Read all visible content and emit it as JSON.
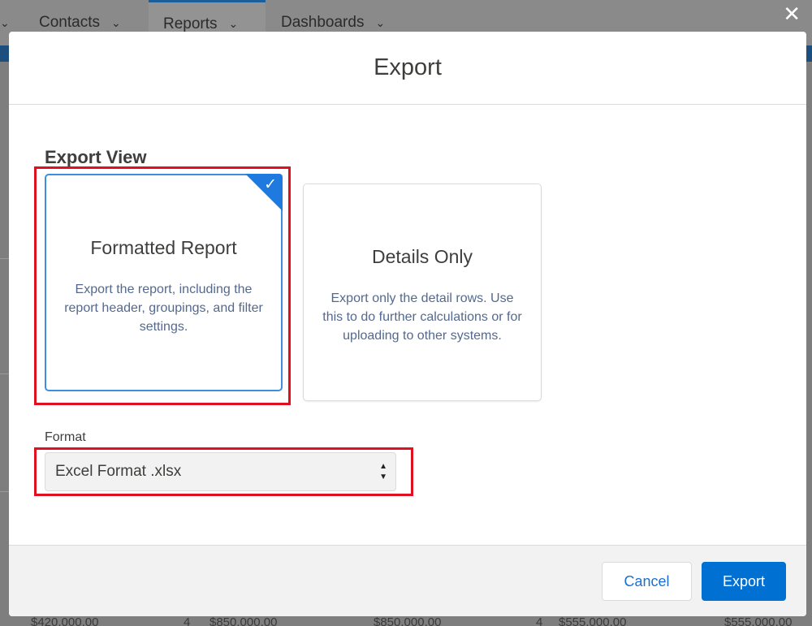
{
  "background": {
    "nav_tabs": [
      {
        "label": "Contacts"
      },
      {
        "label": "Reports"
      },
      {
        "label": "Dashboards"
      }
    ],
    "bottom_values": [
      "$420,000.00",
      "4",
      "$850,000.00",
      "$850,000.00",
      "4",
      "$555,000.00",
      "$555,000.00"
    ]
  },
  "modal": {
    "title": "Export",
    "export_view_label": "Export View",
    "options": [
      {
        "title": "Formatted Report",
        "description": "Export the report, including the report header, groupings, and filter settings.",
        "selected": true
      },
      {
        "title": "Details Only",
        "description": "Export only the detail rows. Use this to do further calculations or for uploading to other systems.",
        "selected": false
      }
    ],
    "format_label": "Format",
    "format_value": "Excel Format .xlsx",
    "cancel_label": "Cancel",
    "export_label": "Export"
  },
  "colors": {
    "accent": "#0070d2",
    "selected_border": "#3d8fdd",
    "highlight": "#e01020"
  },
  "icons": {
    "close": "close-icon",
    "check": "check-icon",
    "chevron": "chevron-down-icon",
    "select_arrows": "up-down-arrows-icon"
  }
}
